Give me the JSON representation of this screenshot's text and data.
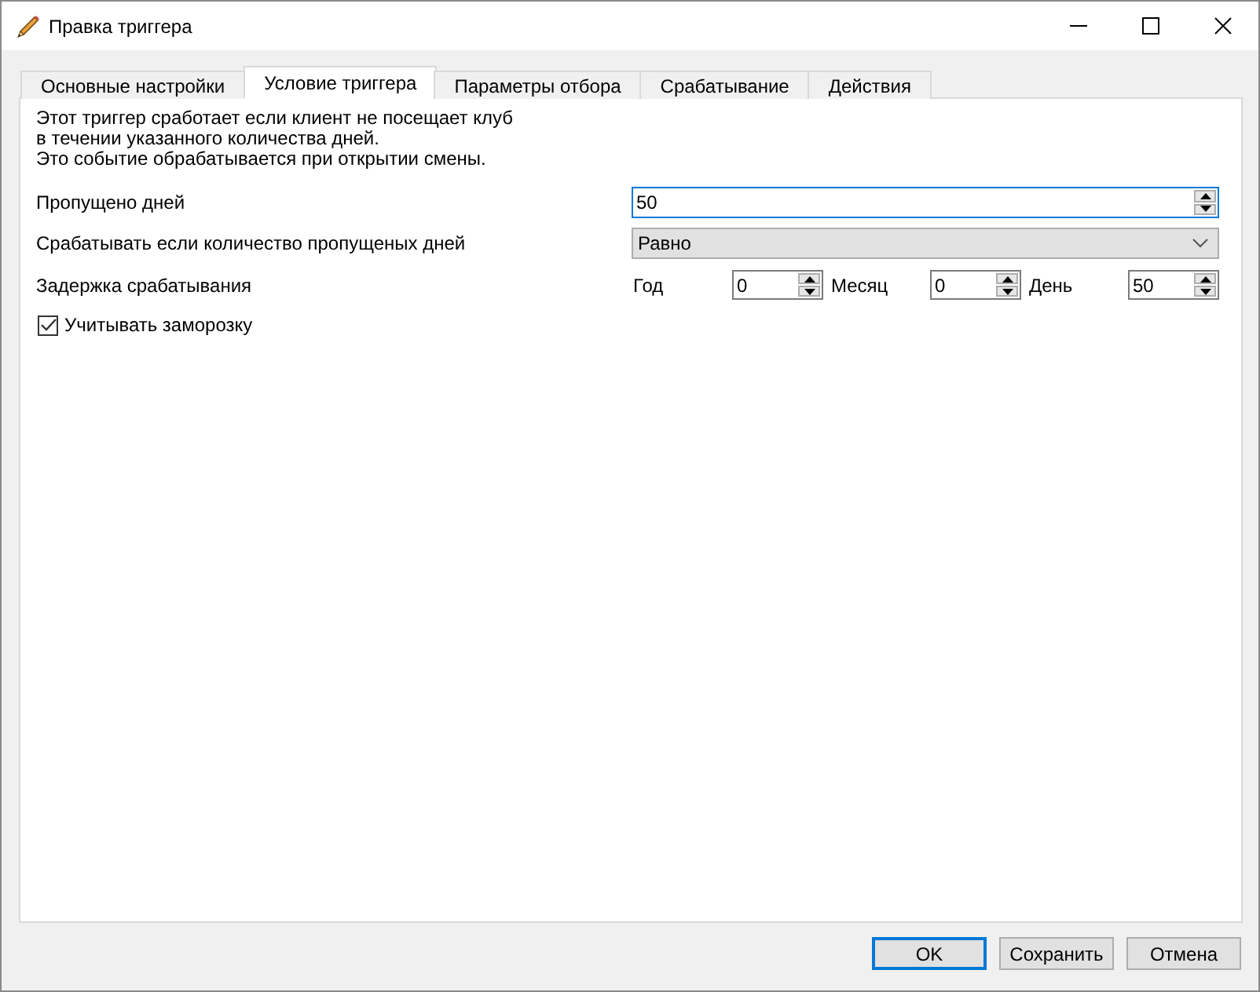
{
  "window": {
    "title": "Правка триггера"
  },
  "tabs": [
    {
      "label": "Основные настройки",
      "selected": false
    },
    {
      "label": "Условие триггера",
      "selected": true
    },
    {
      "label": "Параметры отбора",
      "selected": false
    },
    {
      "label": "Срабатывание",
      "selected": false
    },
    {
      "label": "Действия",
      "selected": false
    }
  ],
  "description": [
    "Этот триггер сработает если клиент не посещает клуб",
    "в течении указанного количества дней.",
    "Это событие обрабатывается при открытии смены."
  ],
  "skipped_days": {
    "label": "Пропущено дней",
    "value": "50",
    "focused": true
  },
  "condition": {
    "label": "Срабатывать если количество пропущеных дней",
    "value": "Равно"
  },
  "delay": {
    "label": "Задержка срабатывания",
    "parts": [
      {
        "label": "Год",
        "value": "0",
        "focused": false
      },
      {
        "label": "Месяц",
        "value": "0",
        "focused": false
      },
      {
        "label": "День",
        "value": "50",
        "focused": false
      }
    ]
  },
  "freeze": {
    "label": "Учитывать заморозку",
    "checked": true
  },
  "buttons": [
    {
      "label": "OK",
      "default": true
    },
    {
      "label": "Сохранить",
      "default": false
    },
    {
      "label": "Отмена",
      "default": false
    }
  ]
}
